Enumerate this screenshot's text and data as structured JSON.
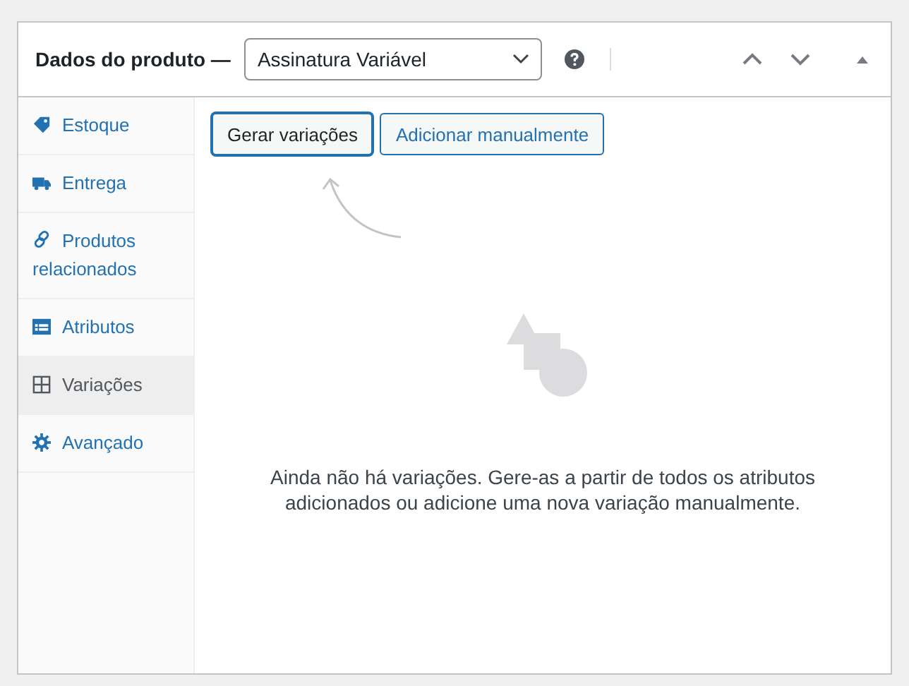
{
  "header": {
    "title": "Dados do produto —",
    "product_type": "Assinatura Variável"
  },
  "sidebar": {
    "items": [
      {
        "label": "Estoque",
        "selected": false
      },
      {
        "label": "Entrega",
        "selected": false
      },
      {
        "label": "Produtos relacionados",
        "selected": false
      },
      {
        "label": "Atributos",
        "selected": false
      },
      {
        "label": "Variações",
        "selected": true
      },
      {
        "label": "Avançado",
        "selected": false
      }
    ]
  },
  "buttons": [
    {
      "label": "Gerar variações",
      "selected": true
    },
    {
      "label": "Adicionar manualmente",
      "selected": false
    }
  ],
  "empty_message": "Ainda não há variações. Gere-as a partir de todos os atributos adicionados ou adicione uma nova variação manualmente."
}
